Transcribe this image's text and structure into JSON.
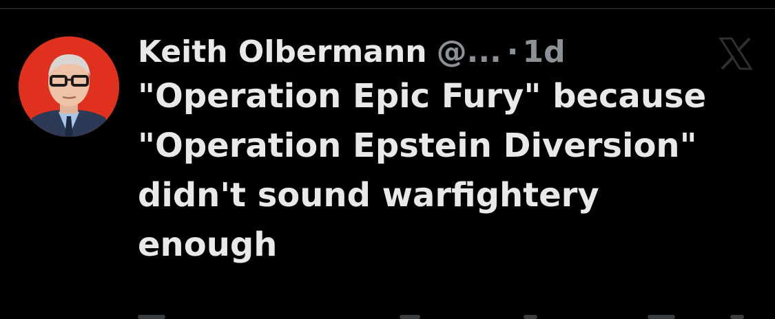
{
  "tweet": {
    "author_name": "Keith Olbermann",
    "handle": "@...",
    "separator": "·",
    "timestamp": "1d",
    "text_lines": [
      "\"Operation Epic Fury\" because",
      "\"Operation Epstein Diversion\"",
      "didn't sound warfightery",
      "enough"
    ]
  },
  "icons": {
    "avatar": "profile-photo",
    "watermark": "x-logo-icon"
  },
  "colors": {
    "background": "#000000",
    "text_primary": "#e7e9ea",
    "text_secondary": "#8b9196",
    "avatar_background": "#e0301e"
  }
}
